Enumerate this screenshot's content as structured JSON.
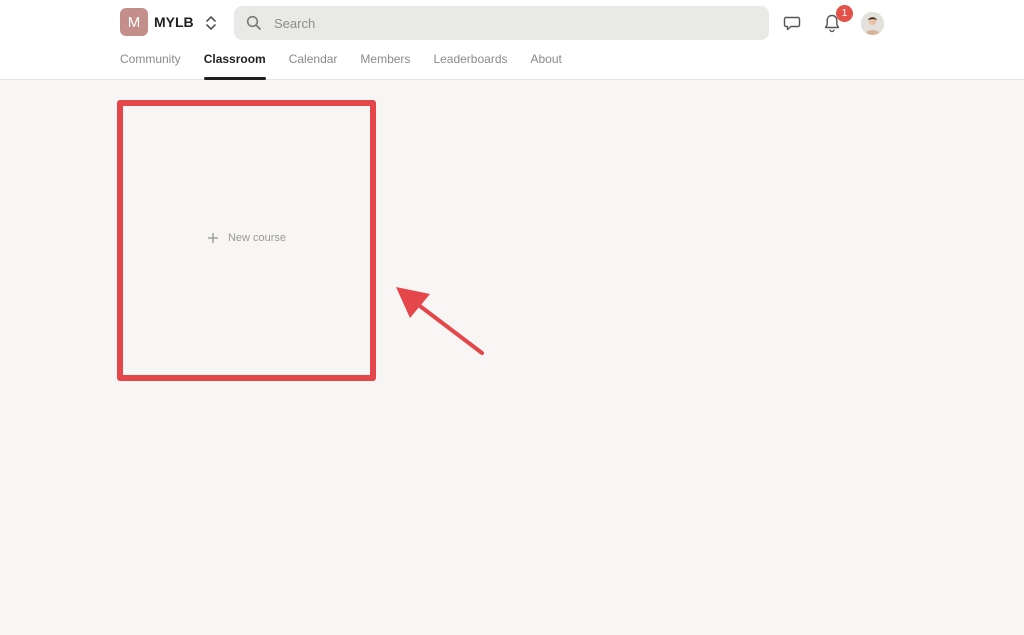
{
  "app": {
    "logo_letter": "M",
    "name": "MYLB"
  },
  "search": {
    "placeholder": "Search",
    "icon": "search-icon"
  },
  "header": {
    "chat_icon": "chat-bubble-icon",
    "bell_icon": "bell-icon",
    "notification_count": "1",
    "avatar": "user-avatar"
  },
  "nav": {
    "tabs": [
      {
        "label": "Community",
        "active": false
      },
      {
        "label": "Classroom",
        "active": true
      },
      {
        "label": "Calendar",
        "active": false
      },
      {
        "label": "Members",
        "active": false
      },
      {
        "label": "Leaderboards",
        "active": false
      },
      {
        "label": "About",
        "active": false
      }
    ]
  },
  "classroom": {
    "new_course_label": "New course",
    "new_course_icon": "plus-icon"
  },
  "colors": {
    "brand_badge": "#c48f8a",
    "highlight": "#e5464a",
    "notification": "#e25248",
    "background": "#f7f6f4"
  }
}
